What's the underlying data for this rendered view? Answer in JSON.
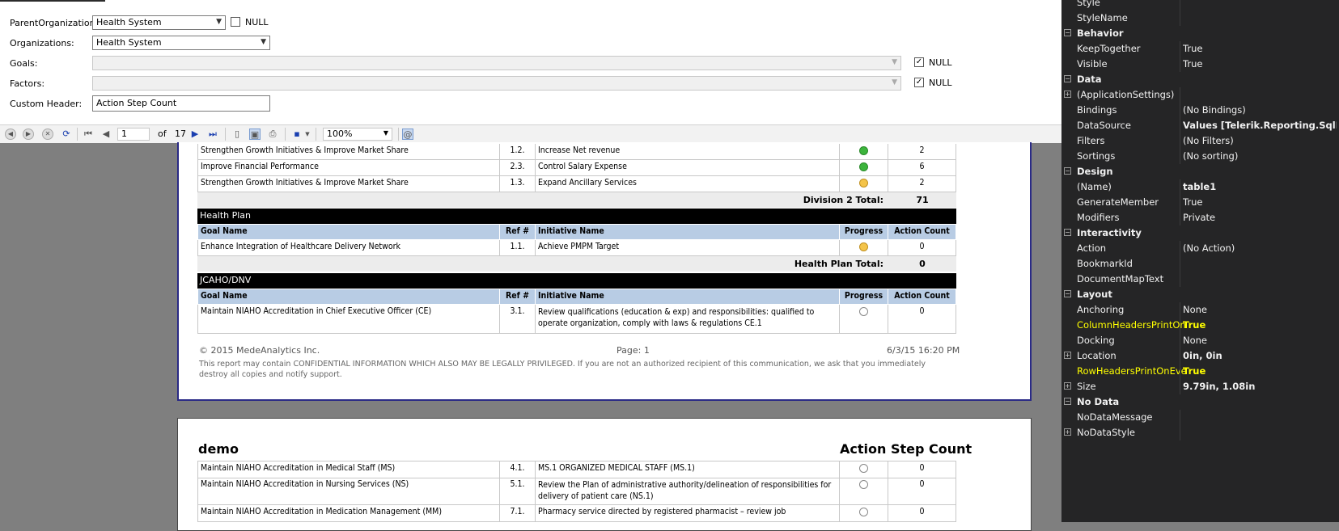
{
  "params": {
    "parent_org": {
      "label": "ParentOrganizations:",
      "value": "Health System",
      "null_label": "NULL",
      "null_checked": false
    },
    "orgs": {
      "label": "Organizations:",
      "value": "Health System"
    },
    "goals": {
      "label": "Goals:",
      "null_label": "NULL",
      "null_checked": true
    },
    "factors": {
      "label": "Factors:",
      "null_label": "NULL",
      "null_checked": true
    },
    "custom_header": {
      "label": "Custom Header:",
      "value": "Action Step Count"
    }
  },
  "toolbar": {
    "page": "1",
    "of_label": "of",
    "total": "17",
    "zoom": "100%"
  },
  "report": {
    "rows_top": [
      {
        "goal": "Strengthen Growth Initiatives & Improve Market Share",
        "ref": "1.2.",
        "init": "Increase Net revenue",
        "progress": "green",
        "count": "2"
      },
      {
        "goal": "Improve Financial Performance",
        "ref": "2.3.",
        "init": "Control Salary Expense",
        "progress": "green",
        "count": "6"
      },
      {
        "goal": "Strengthen Growth Initiatives & Improve Market Share",
        "ref": "1.3.",
        "init": "Expand Ancillary Services",
        "progress": "yellow",
        "count": "2"
      }
    ],
    "div2_total": {
      "label": "Division 2 Total:",
      "value": "71"
    },
    "hp_section": "Health Plan",
    "headers": {
      "goal": "Goal Name",
      "ref": "Ref #",
      "init": "Initiative Name",
      "progress": "Progress",
      "count": "Action Count"
    },
    "hp_rows": [
      {
        "goal": "Enhance Integration of Healthcare Delivery Network",
        "ref": "1.1.",
        "init": "Achieve PMPM Target",
        "progress": "yellow",
        "count": "0"
      }
    ],
    "hp_total": {
      "label": "Health Plan Total:",
      "value": "0"
    },
    "jc_section": "JCAHO/DNV",
    "jc_rows": [
      {
        "goal": "Maintain NIAHO Accreditation in Chief Executive Officer (CE)",
        "ref": "3.1.",
        "init": "Review qualifications (education & exp) and responsibilities: qualified to operate organization, comply with laws & regulations CE.1",
        "progress": "empty",
        "count": "0"
      }
    ],
    "footer": {
      "copyright": "© 2015 MedeAnalytics Inc.",
      "page": "Page: 1",
      "date": "6/3/15 16:20 PM",
      "disclaimer": "This report may contain CONFIDENTIAL INFORMATION WHICH ALSO MAY BE LEGALLY PRIVILEGED. If you are not an authorized recipient of this communication, we ask that you immediately destroy all copies and notify support."
    },
    "page2": {
      "title": "demo",
      "header": "Action Step Count",
      "rows": [
        {
          "goal": "Maintain NIAHO Accreditation in Medical Staff (MS)",
          "ref": "4.1.",
          "init": "MS.1 ORGANIZED MEDICAL STAFF (MS.1)",
          "progress": "empty",
          "count": "0"
        },
        {
          "goal": "Maintain NIAHO Accreditation in Nursing Services (NS)",
          "ref": "5.1.",
          "init": "Review the Plan of administrative authority/delineation of responsibilities for delivery of patient care (NS.1)",
          "progress": "empty",
          "count": "0"
        },
        {
          "goal": "Maintain NIAHO Accreditation in Medication Management (MM)",
          "ref": "7.1.",
          "init": "Pharmacy service directed by registered pharmacist – review job",
          "progress": "empty",
          "count": "0"
        }
      ]
    }
  },
  "properties": [
    {
      "kind": "prop",
      "name": "Style",
      "value": ""
    },
    {
      "kind": "prop",
      "name": "StyleName",
      "value": ""
    },
    {
      "kind": "cat",
      "name": "Behavior"
    },
    {
      "kind": "prop",
      "name": "KeepTogether",
      "value": "True"
    },
    {
      "kind": "prop",
      "name": "Visible",
      "value": "True"
    },
    {
      "kind": "cat",
      "name": "Data"
    },
    {
      "kind": "exp",
      "name": "(ApplicationSettings)",
      "value": ""
    },
    {
      "kind": "prop",
      "name": "Bindings",
      "value": "(No Bindings)"
    },
    {
      "kind": "prop",
      "name": "DataSource",
      "value": "Values [Telerik.Reporting.SqlDataS",
      "bold": true
    },
    {
      "kind": "prop",
      "name": "Filters",
      "value": "(No Filters)"
    },
    {
      "kind": "prop",
      "name": "Sortings",
      "value": "(No sorting)"
    },
    {
      "kind": "cat",
      "name": "Design"
    },
    {
      "kind": "prop",
      "name": "(Name)",
      "value": "table1",
      "bold": true
    },
    {
      "kind": "prop",
      "name": "GenerateMember",
      "value": "True"
    },
    {
      "kind": "prop",
      "name": "Modifiers",
      "value": "Private"
    },
    {
      "kind": "cat",
      "name": "Interactivity"
    },
    {
      "kind": "prop",
      "name": "Action",
      "value": "(No Action)"
    },
    {
      "kind": "prop",
      "name": "BookmarkId",
      "value": ""
    },
    {
      "kind": "prop",
      "name": "DocumentMapText",
      "value": ""
    },
    {
      "kind": "cat",
      "name": "Layout"
    },
    {
      "kind": "prop",
      "name": "Anchoring",
      "value": "None"
    },
    {
      "kind": "prop",
      "name": "ColumnHeadersPrintOn",
      "value": "True",
      "highlight": true
    },
    {
      "kind": "prop",
      "name": "Docking",
      "value": "None"
    },
    {
      "kind": "exp",
      "name": "Location",
      "value": "0in, 0in",
      "bold": true
    },
    {
      "kind": "prop",
      "name": "RowHeadersPrintOnEve",
      "value": "True",
      "highlight": true
    },
    {
      "kind": "exp",
      "name": "Size",
      "value": "9.79in, 1.08in",
      "bold": true
    },
    {
      "kind": "cat",
      "name": "No Data"
    },
    {
      "kind": "prop",
      "name": "NoDataMessage",
      "value": ""
    },
    {
      "kind": "exp",
      "name": "NoDataStyle",
      "value": ""
    }
  ]
}
